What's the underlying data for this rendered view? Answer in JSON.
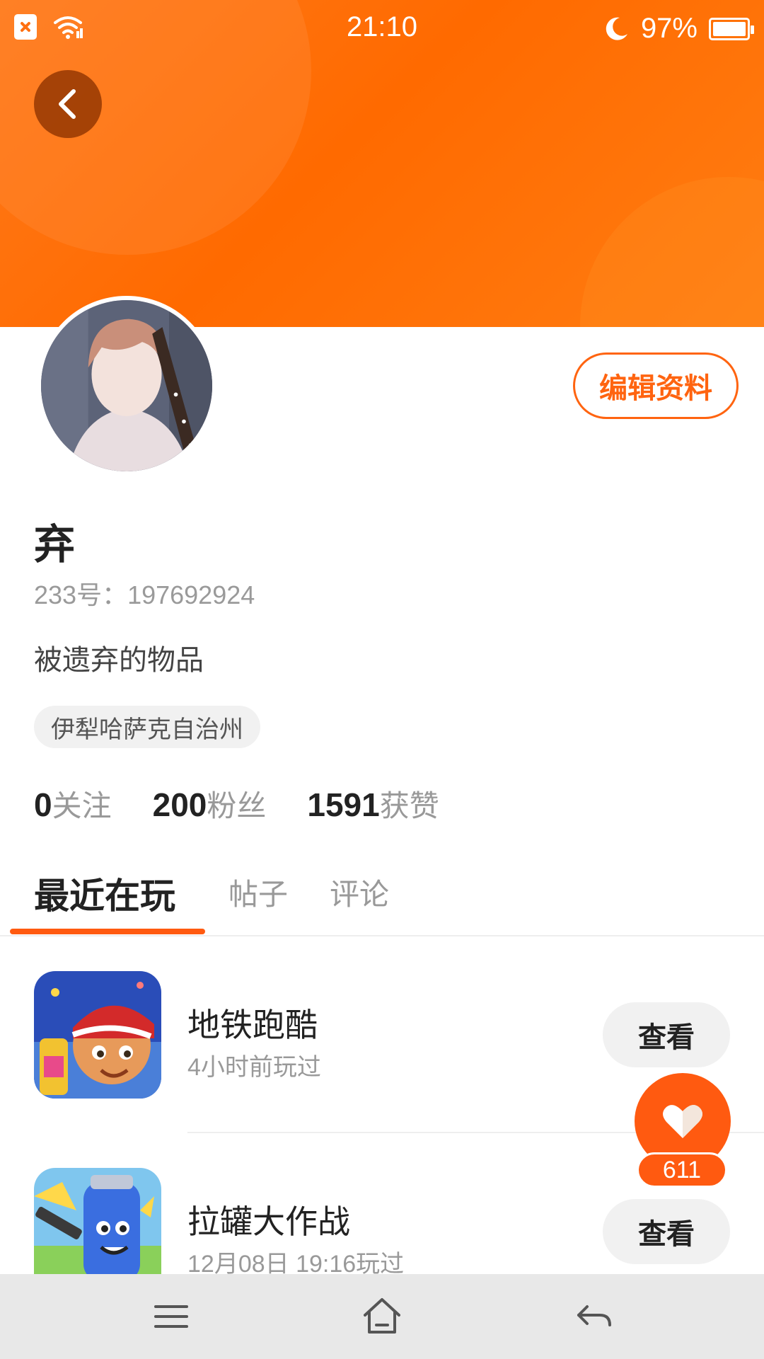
{
  "status_bar": {
    "time": "21:10",
    "battery": "97%",
    "icons": [
      "sim-blocked-icon",
      "wifi-icon",
      "moon-icon",
      "battery-icon"
    ]
  },
  "profile": {
    "username": "弃",
    "user_id": "233号：197692924",
    "bio": "被遗弃的物品",
    "location": "伊犁哈萨克自治州",
    "edit_label": "编辑资料"
  },
  "stats": [
    {
      "num": "0",
      "label": "关注"
    },
    {
      "num": "200",
      "label": "粉丝"
    },
    {
      "num": "1591",
      "label": "获赞"
    }
  ],
  "tabs": [
    {
      "label": "最近在玩",
      "active": true
    },
    {
      "label": "帖子",
      "active": false
    },
    {
      "label": "评论",
      "active": false
    }
  ],
  "games": [
    {
      "name": "地铁跑酷",
      "time": "4小时前玩过",
      "button": "查看"
    },
    {
      "name": "拉罐大作战",
      "time": "12月08日 19:16玩过",
      "button": "查看"
    }
  ],
  "like": {
    "count": "611"
  },
  "colors": {
    "accent": "#ff5a10",
    "banner": "#ff6a00"
  }
}
